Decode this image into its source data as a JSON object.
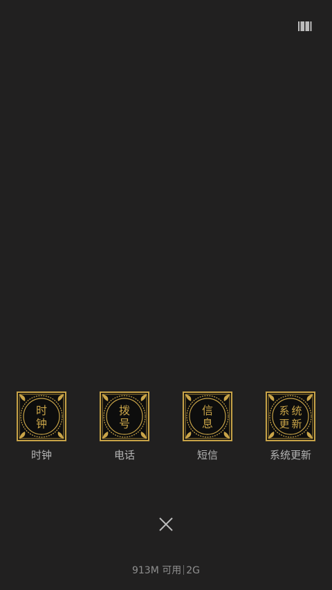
{
  "toolbar": {
    "view_toggle_icon": "list-view-icon"
  },
  "recent_apps": [
    {
      "label": "时钟",
      "tile_text": [
        "时",
        "钟"
      ],
      "icon": "clock-app-tile-icon"
    },
    {
      "label": "电话",
      "tile_text": [
        "拨",
        "号"
      ],
      "icon": "phone-app-tile-icon"
    },
    {
      "label": "短信",
      "tile_text": [
        "信",
        "息"
      ],
      "icon": "messages-app-tile-icon"
    },
    {
      "label": "系统更新",
      "tile_text": [
        "系",
        "统",
        "更",
        "新"
      ],
      "icon": "system-update-app-tile-icon"
    }
  ],
  "close_icon": "close-icon",
  "memory": {
    "available": "913M 可用",
    "total": "2G"
  },
  "colors": {
    "background": "#212020",
    "tile_gold": "#c9a448",
    "tile_black": "#0d0d0d",
    "label": "#b4b4b4"
  }
}
